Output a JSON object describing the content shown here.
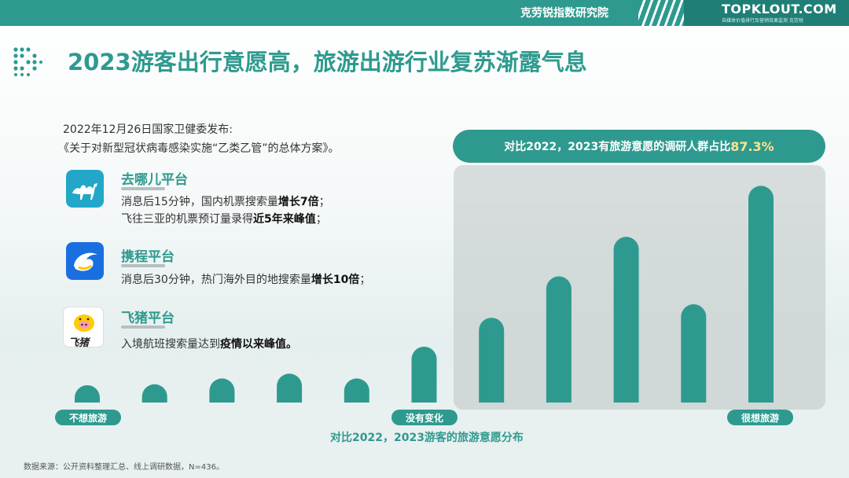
{
  "header": {
    "institute": "克劳锐指数研究院",
    "logo": "TOPKLOUT.COM",
    "slogan": "自媒体价值排行及营销效果监测  克劳锐"
  },
  "page_title": "2023游客出行意愿高，旅游出游行业复苏渐露气息",
  "notice": {
    "line1": "2022年12月26日国家卫健委发布:",
    "line2": "《关于对新型冠状病毒感染实施“乙类乙管”的总体方案》。"
  },
  "platforms": [
    {
      "name": "去哪儿平台",
      "icon": "camel-icon",
      "lines": [
        {
          "pre": "消息后15分钟，国内机票搜索量",
          "bold": "增长7倍",
          "post": "；"
        },
        {
          "pre": "飞往三亚的机票预订量录得",
          "bold": "近5年来峰值",
          "post": "；"
        }
      ]
    },
    {
      "name": "携程平台",
      "icon": "dolphin-icon",
      "lines": [
        {
          "pre": "消息后30分钟，热门海外目的地搜索量",
          "bold": "增长10倍",
          "post": "；"
        }
      ]
    },
    {
      "name": "飞猪平台",
      "icon": "pig-icon",
      "icon_text": "飞猪",
      "lines": [
        {
          "pre": "入境航班搜索量达到",
          "bold": "疫情以来峰值。",
          "post": ""
        }
      ]
    }
  ],
  "banner": {
    "text": "对比2022，2023有旅游意愿的调研人群占比",
    "highlight": "87.3%"
  },
  "chart_data": {
    "type": "bar",
    "title": "",
    "caption": "对比2022，2023游客的旅游意愿分布",
    "categories": [
      "1",
      "2",
      "3",
      "4",
      "5",
      "6",
      "7",
      "8",
      "9",
      "10",
      "11"
    ],
    "values": [
      1.8,
      1.9,
      2.5,
      3.0,
      2.5,
      5.8,
      8.8,
      13.1,
      17.2,
      10.2,
      22.5
    ],
    "ylim": [
      0,
      24
    ],
    "axis_labels": {
      "left": "不想旅游",
      "middle": "没有变化",
      "right": "很想旅游"
    },
    "bar_color": "#2e9a8f",
    "grid": false,
    "legend": "none"
  },
  "source": "数据来源：公开资料整理汇总、线上调研数据，N=436。",
  "colors": {
    "accent": "#2e9a8f",
    "highlight": "#ffe38a"
  }
}
